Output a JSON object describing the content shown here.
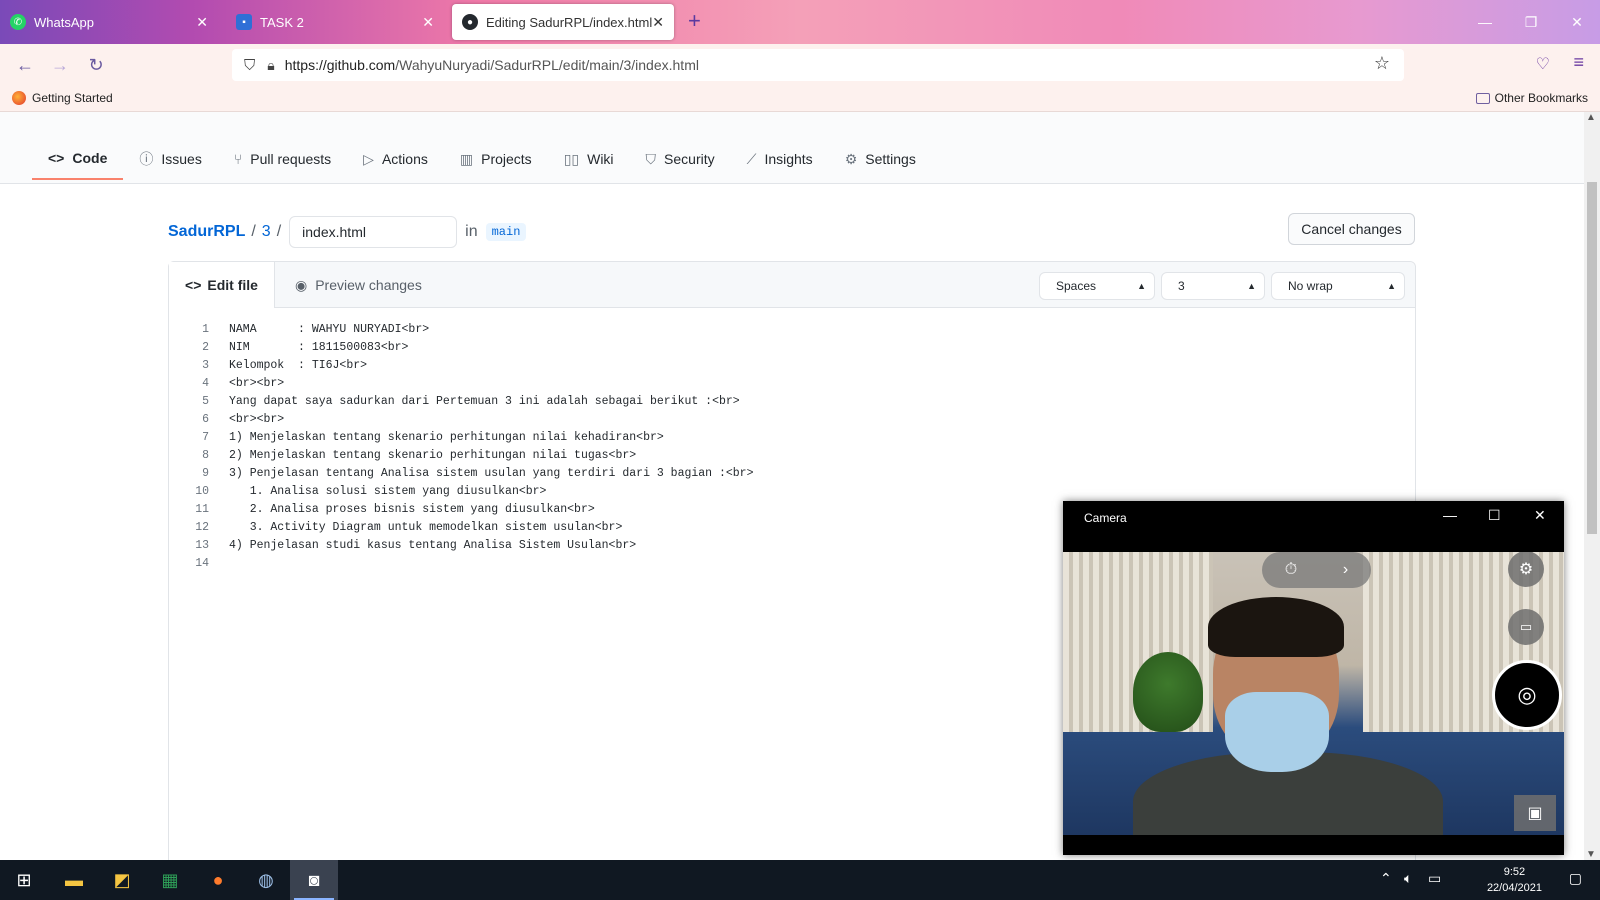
{
  "browser": {
    "tabs": [
      {
        "label": "WhatsApp",
        "icon": "whatsapp-icon"
      },
      {
        "label": "TASK 2",
        "icon": "contacts-icon"
      },
      {
        "label": "Editing SadurRPL/index.html at",
        "icon": "github-icon"
      }
    ],
    "url_host": "https://github.com",
    "url_path": "/WahyuNuryadi/SadurRPL/edit/main/3/index.html",
    "bookmarks": {
      "getting_started": "Getting Started",
      "other": "Other Bookmarks"
    }
  },
  "repo_nav": [
    {
      "label": "Code",
      "icon": "code-icon"
    },
    {
      "label": "Issues",
      "icon": "issue-icon"
    },
    {
      "label": "Pull requests",
      "icon": "pull-request-icon"
    },
    {
      "label": "Actions",
      "icon": "play-icon"
    },
    {
      "label": "Projects",
      "icon": "project-icon"
    },
    {
      "label": "Wiki",
      "icon": "book-icon"
    },
    {
      "label": "Security",
      "icon": "shield-icon"
    },
    {
      "label": "Insights",
      "icon": "graph-icon"
    },
    {
      "label": "Settings",
      "icon": "gear-icon"
    }
  ],
  "breadcrumb": {
    "repo": "SadurRPL",
    "folder": "3",
    "filename": "index.html",
    "in": "in",
    "branch": "main"
  },
  "cancel_label": "Cancel changes",
  "editor": {
    "edit_tab": "Edit file",
    "preview_tab": "Preview changes",
    "indent_mode": "Spaces",
    "indent_size": "3",
    "wrap_mode": "No wrap",
    "lines": [
      "NAMA      : WAHYU NURYADI<br>",
      "NIM       : 1811500083<br>",
      "Kelompok  : TI6J<br>",
      "<br><br>",
      "Yang dapat saya sadurkan dari Pertemuan 3 ini adalah sebagai berikut :<br>",
      "<br><br>",
      "1) Menjelaskan tentang skenario perhitungan nilai kehadiran<br>",
      "2) Menjelaskan tentang skenario perhitungan nilai tugas<br>",
      "3) Penjelasan tentang Analisa sistem usulan yang terdiri dari 3 bagian :<br>",
      "   1. Analisa solusi sistem yang diusulkan<br>",
      "   2. Analisa proses bisnis sistem yang diusulkan<br>",
      "   3. Activity Diagram untuk memodelkan sistem usulan<br>",
      "4) Penjelasan studi kasus tentang Analisa Sistem Usulan<br>",
      ""
    ]
  },
  "camera": {
    "title": "Camera"
  },
  "taskbar": {
    "time": "9:52",
    "date": "22/04/2021"
  }
}
